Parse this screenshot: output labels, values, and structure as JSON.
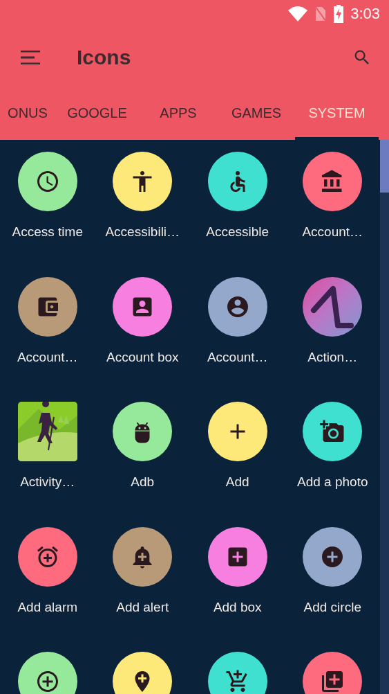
{
  "status_bar": {
    "time": "3:03"
  },
  "toolbar": {
    "title": "Icons"
  },
  "tabs": [
    {
      "label": "ONUS",
      "selected": false
    },
    {
      "label": "GOOGLE",
      "selected": false
    },
    {
      "label": "APPS",
      "selected": false
    },
    {
      "label": "GAMES",
      "selected": false
    },
    {
      "label": "SYSTEM",
      "selected": true
    }
  ],
  "items": [
    {
      "label": "Access time",
      "kind": "circle",
      "color": "#96e89a"
    },
    {
      "label": "Accessibili…",
      "kind": "circle",
      "color": "#fde97a"
    },
    {
      "label": "Accessible",
      "kind": "circle",
      "color": "#40e0d0"
    },
    {
      "label": "Account…",
      "kind": "circle",
      "color": "#ff6b7e"
    },
    {
      "label": "Account…",
      "kind": "circle",
      "color": "#b89a78"
    },
    {
      "label": "Account box",
      "kind": "circle",
      "color": "#f77fe0"
    },
    {
      "label": "Account…",
      "kind": "circle",
      "color": "#94a8cc"
    },
    {
      "label": "Action…",
      "kind": "logo"
    },
    {
      "label": "Activity…",
      "kind": "picture"
    },
    {
      "label": "Adb",
      "kind": "circle",
      "color": "#96e89a"
    },
    {
      "label": "Add",
      "kind": "circle",
      "color": "#fde97a"
    },
    {
      "label": "Add a photo",
      "kind": "circle",
      "color": "#40e0d0"
    },
    {
      "label": "Add alarm",
      "kind": "circle",
      "color": "#ff6b7e"
    },
    {
      "label": "Add alert",
      "kind": "circle",
      "color": "#b89a78"
    },
    {
      "label": "Add box",
      "kind": "circle",
      "color": "#f77fe0"
    },
    {
      "label": "Add circle",
      "kind": "circle",
      "color": "#94a8cc"
    },
    {
      "kind": "circle",
      "color": "#96e89a"
    },
    {
      "kind": "circle",
      "color": "#fde97a"
    },
    {
      "kind": "circle",
      "color": "#40e0d0"
    },
    {
      "kind": "circle",
      "color": "#ff6b7e"
    }
  ]
}
